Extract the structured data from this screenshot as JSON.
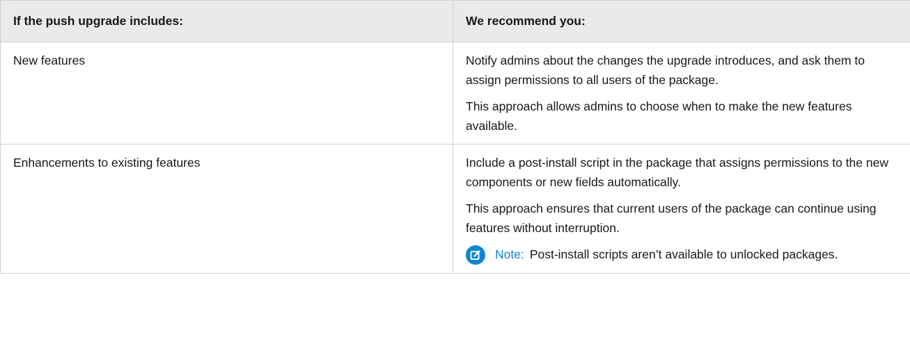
{
  "table": {
    "headers": [
      "If the push upgrade includes:",
      "We recommend you:"
    ],
    "rows": [
      {
        "includes": "New features",
        "recommend": [
          "Notify admins about the changes the upgrade introduces, and ask them to assign permissions to all users of the package.",
          "This approach allows admins to choose when to make the new features available."
        ]
      },
      {
        "includes": "Enhancements to existing features",
        "recommend": [
          "Include a post-install script in the package that assigns permissions to the new components or new fields automatically.",
          "This approach ensures that current users of the package can continue using features without interruption."
        ],
        "note": {
          "icon": "edit-note-icon",
          "label": "Note:",
          "text": "Post-install scripts aren’t available to unlocked packages."
        }
      }
    ]
  },
  "colors": {
    "header_bg": "#eaeaea",
    "border": "#d0d0d0",
    "note_accent": "#0d86d4"
  }
}
